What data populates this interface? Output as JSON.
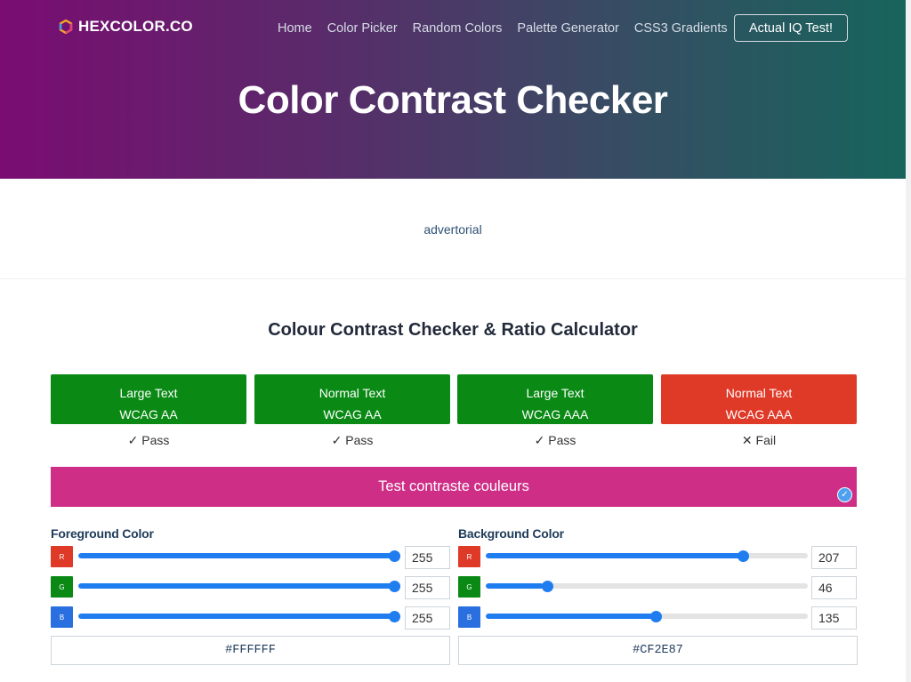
{
  "header": {
    "logo_text": "HEXCOLOR.CO",
    "nav": [
      "Home",
      "Color Picker",
      "Random Colors",
      "Palette Generator",
      "CSS3 Gradients"
    ],
    "cta_label": "Actual IQ Test!",
    "title": "Color Contrast Checker"
  },
  "ad_label": "advertorial",
  "tool": {
    "title": "Colour Contrast Checker & Ratio Calculator",
    "badges": [
      {
        "line1": "Large Text",
        "line2": "WCAG AA",
        "status": "pass",
        "result": "✓ Pass"
      },
      {
        "line1": "Normal Text",
        "line2": "WCAG AA",
        "status": "pass",
        "result": "✓ Pass"
      },
      {
        "line1": "Large Text",
        "line2": "WCAG AAA",
        "status": "pass",
        "result": "✓ Pass"
      },
      {
        "line1": "Normal Text",
        "line2": "WCAG AAA",
        "status": "fail",
        "result": "✕ Fail"
      }
    ],
    "sample_text": "Test contraste couleurs",
    "sample_colors": {
      "foreground": "#FFFFFF",
      "background": "#CF2E87"
    },
    "foreground": {
      "label": "Foreground Color",
      "channels": [
        {
          "name": "R",
          "value": 255
        },
        {
          "name": "G",
          "value": 255
        },
        {
          "name": "B",
          "value": 255
        }
      ],
      "hex": "#FFFFFF"
    },
    "background": {
      "label": "Background Color",
      "channels": [
        {
          "name": "R",
          "value": 207
        },
        {
          "name": "G",
          "value": 46
        },
        {
          "name": "B",
          "value": 135
        }
      ],
      "hex": "#CF2E87"
    }
  },
  "colors": {
    "pass": "#0A8A15",
    "fail": "#DF3A28",
    "accent": "#1F7DF0"
  }
}
